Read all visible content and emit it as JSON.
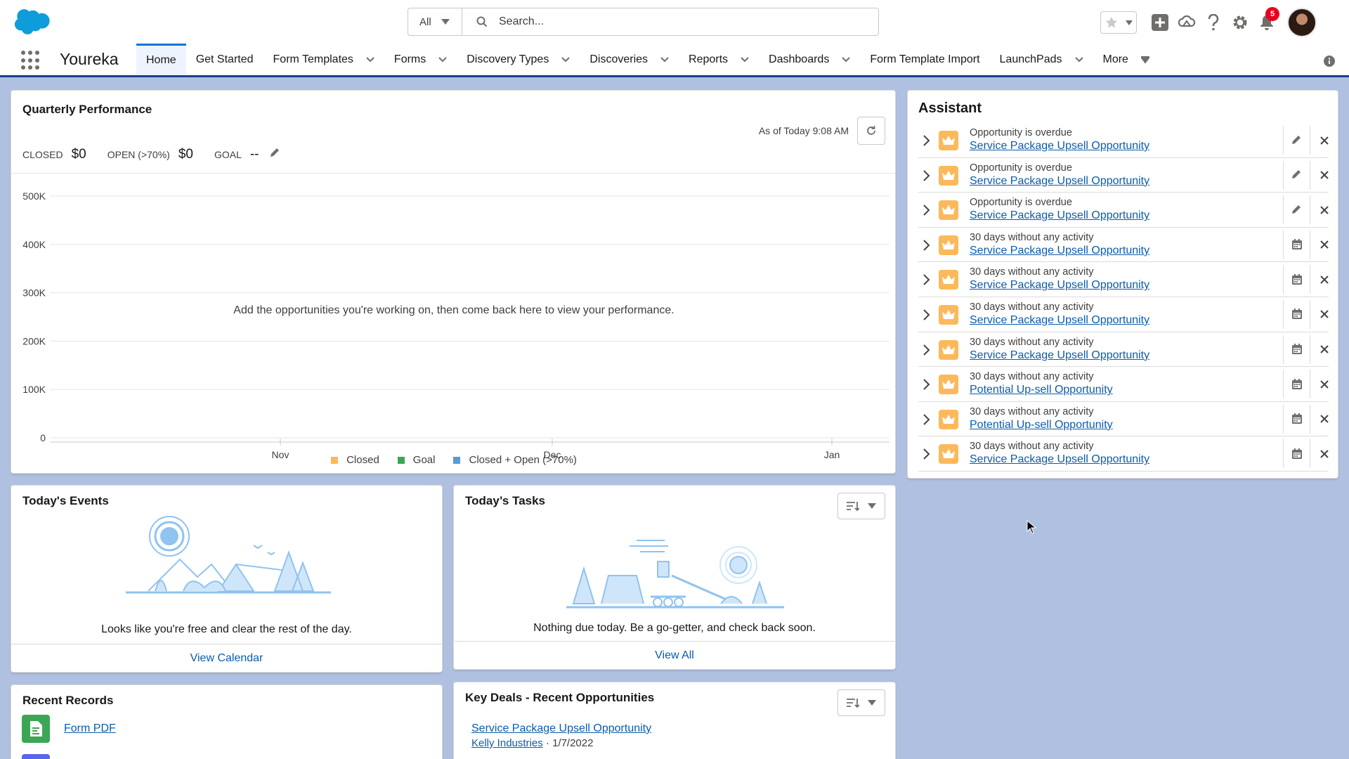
{
  "header": {
    "search_scope": "All",
    "search_placeholder": "Search...",
    "notification_count": "5"
  },
  "nav": {
    "app_name": "Youreka",
    "items": [
      {
        "label": "Home",
        "active": true,
        "has_menu": false
      },
      {
        "label": "Get Started",
        "has_menu": false
      },
      {
        "label": "Form Templates",
        "has_menu": true
      },
      {
        "label": "Forms",
        "has_menu": true
      },
      {
        "label": "Discovery Types",
        "has_menu": true
      },
      {
        "label": "Discoveries",
        "has_menu": true
      },
      {
        "label": "Reports",
        "has_menu": true
      },
      {
        "label": "Dashboards",
        "has_menu": true
      },
      {
        "label": "Form Template Import",
        "has_menu": false
      },
      {
        "label": "LaunchPads",
        "has_menu": true
      },
      {
        "label": "More",
        "has_menu": true
      }
    ]
  },
  "quarterly": {
    "title": "Quarterly Performance",
    "as_of": "As of Today 9:08 AM",
    "closed_label": "CLOSED",
    "closed_value": "$0",
    "open_label": "OPEN (>70%)",
    "open_value": "$0",
    "goal_label": "GOAL",
    "goal_value": "--",
    "empty_message": "Add the opportunities you're working on, then come back here to view your performance."
  },
  "chart_data": {
    "type": "line",
    "x_ticks": [
      "Nov",
      "Dec",
      "Jan"
    ],
    "y_ticks": [
      "500K",
      "400K",
      "300K",
      "200K",
      "100K",
      "0"
    ],
    "ylim": [
      0,
      500000
    ],
    "series": [
      {
        "name": "Closed",
        "color": "#fcb95b",
        "values": []
      },
      {
        "name": "Goal",
        "color": "#3ba755",
        "values": []
      },
      {
        "name": "Closed + Open (>70%)",
        "color": "#5a9bd5",
        "values": []
      }
    ],
    "legend_position": "bottom",
    "grid": true
  },
  "assistant": {
    "title": "Assistant",
    "items": [
      {
        "type": "Opportunity is overdue",
        "link": "Service Package Upsell Opportunity",
        "action": "edit"
      },
      {
        "type": "Opportunity is overdue",
        "link": "Service Package Upsell Opportunity",
        "action": "edit"
      },
      {
        "type": "Opportunity is overdue",
        "link": "Service Package Upsell Opportunity",
        "action": "edit"
      },
      {
        "type": "30 days without any activity",
        "link": "Service Package Upsell Opportunity",
        "action": "calendar"
      },
      {
        "type": "30 days without any activity",
        "link": "Service Package Upsell Opportunity",
        "action": "calendar"
      },
      {
        "type": "30 days without any activity",
        "link": "Service Package Upsell Opportunity",
        "action": "calendar"
      },
      {
        "type": "30 days without any activity",
        "link": "Service Package Upsell Opportunity",
        "action": "calendar"
      },
      {
        "type": "30 days without any activity",
        "link": "Potential Up-sell Opportunity",
        "action": "calendar"
      },
      {
        "type": "30 days without any activity",
        "link": "Potential Up-sell Opportunity",
        "action": "calendar"
      },
      {
        "type": "30 days without any activity",
        "link": "Service Package Upsell Opportunity",
        "action": "calendar"
      }
    ]
  },
  "events": {
    "title": "Today's Events",
    "message": "Looks like you're free and clear the rest of the day.",
    "footer": "View Calendar"
  },
  "tasks": {
    "title": "Today’s Tasks",
    "message": "Nothing due today. Be a go-getter, and check back soon.",
    "footer": "View All"
  },
  "recent": {
    "title": "Recent Records",
    "items": [
      {
        "label": "Form PDF"
      }
    ]
  },
  "key_deals": {
    "title": "Key Deals - Recent Opportunities",
    "deal_name": "Service Package Upsell Opportunity",
    "account": "Kelly Industries",
    "separator": "·",
    "date": "1/7/2022"
  }
}
